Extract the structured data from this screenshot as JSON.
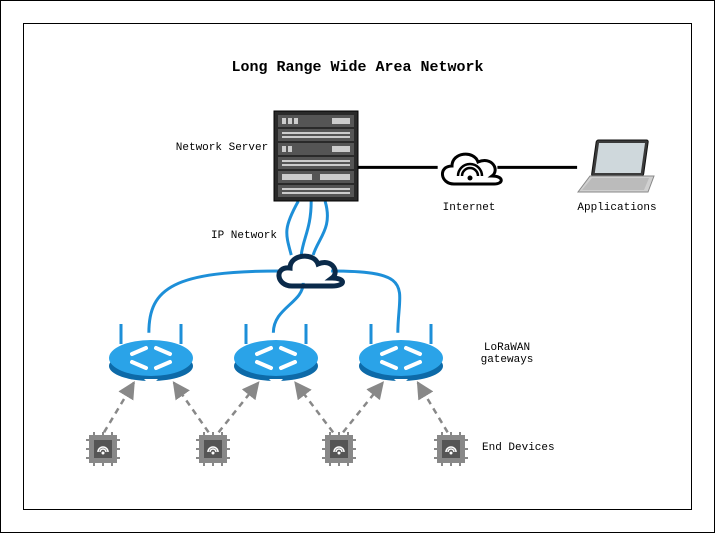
{
  "title": "Long Range Wide Area Network",
  "labels": {
    "network_server": "Network Server",
    "ip_network": "IP Network",
    "internet": "Internet",
    "applications": "Applications",
    "gateways": "LoRaWAN\ngateways",
    "end_devices": "End Devices"
  },
  "diagram": {
    "nodes": [
      {
        "id": "server",
        "type": "server",
        "label_key": "network_server"
      },
      {
        "id": "internet",
        "type": "cloud-wifi",
        "label_key": "internet"
      },
      {
        "id": "laptop",
        "type": "laptop",
        "label_key": "applications"
      },
      {
        "id": "ipcloud",
        "type": "cloud-outline",
        "label_key": "ip_network"
      },
      {
        "id": "gw1",
        "type": "router"
      },
      {
        "id": "gw2",
        "type": "router"
      },
      {
        "id": "gw3",
        "type": "router"
      },
      {
        "id": "dev1",
        "type": "chip"
      },
      {
        "id": "dev2",
        "type": "chip"
      },
      {
        "id": "dev3",
        "type": "chip"
      },
      {
        "id": "dev4",
        "type": "chip"
      }
    ],
    "edges": [
      {
        "from": "server",
        "to": "internet",
        "style": "solid-black"
      },
      {
        "from": "internet",
        "to": "laptop",
        "style": "solid-black"
      },
      {
        "from": "server",
        "to": "ipcloud",
        "style": "blue-curve",
        "count": 3
      },
      {
        "from": "ipcloud",
        "to": "gw1",
        "style": "blue-curve"
      },
      {
        "from": "ipcloud",
        "to": "gw2",
        "style": "blue-curve"
      },
      {
        "from": "ipcloud",
        "to": "gw3",
        "style": "blue-curve"
      },
      {
        "from": "dev1",
        "to": "gw1",
        "style": "dashed-arrow"
      },
      {
        "from": "dev2",
        "to": "gw1",
        "style": "dashed-arrow"
      },
      {
        "from": "dev2",
        "to": "gw2",
        "style": "dashed-arrow"
      },
      {
        "from": "dev3",
        "to": "gw2",
        "style": "dashed-arrow"
      },
      {
        "from": "dev3",
        "to": "gw3",
        "style": "dashed-arrow"
      },
      {
        "from": "dev4",
        "to": "gw3",
        "style": "dashed-arrow"
      }
    ]
  }
}
